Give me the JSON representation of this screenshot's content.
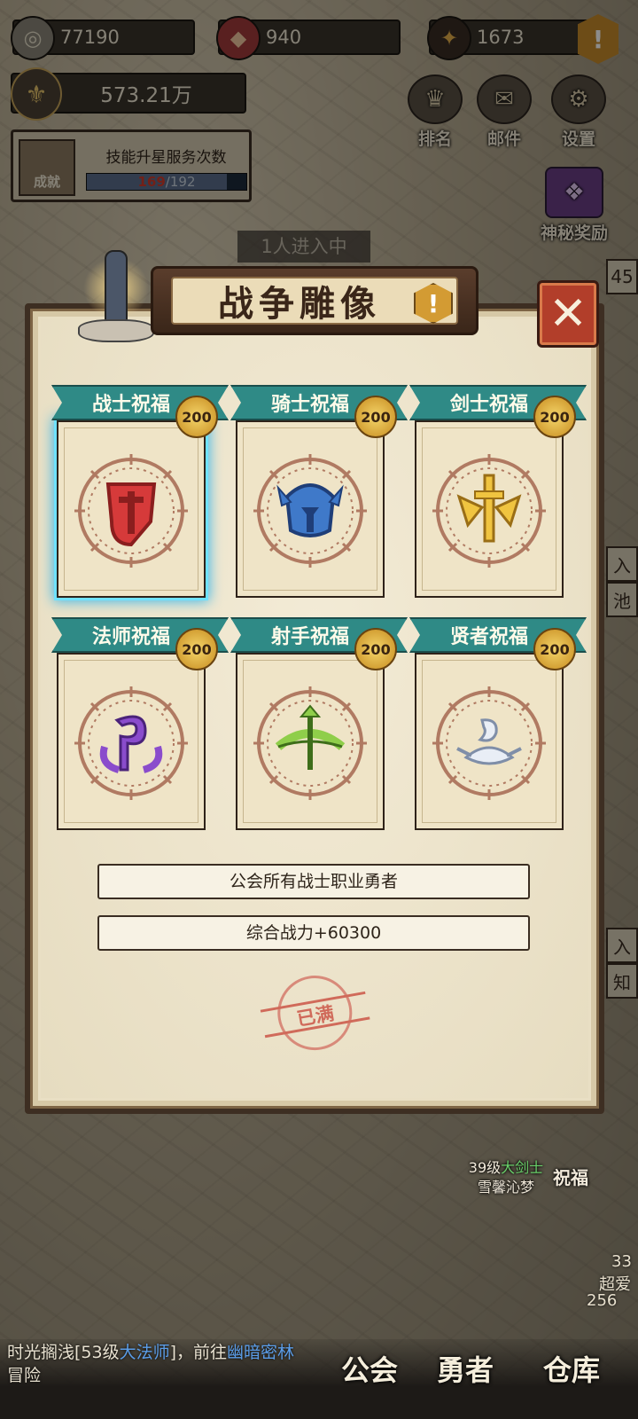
{
  "resources": {
    "gold": "77190",
    "gems": "940",
    "stars": "1673",
    "power": "573.21万"
  },
  "icons": {
    "gold": "coin-icon",
    "gems": "red-gem-icon",
    "stars": "dark-star-icon",
    "alert": "exclamation-icon"
  },
  "top_buttons": {
    "rank": "排名",
    "mail": "邮件",
    "settings": "设置",
    "mystery_reward": "神秘奖励"
  },
  "achievement": {
    "badge": "成就",
    "title": "技能升星服务次数",
    "current": "169",
    "separator": "/",
    "max": "192",
    "progress": 0.88
  },
  "map_banner": "1人进入中",
  "modal": {
    "title": "战争雕像",
    "alert": "!",
    "close": "✕",
    "cards": [
      {
        "label": "战士祝福",
        "level": "200",
        "color": "#d63a3a",
        "accent": "#8a1e1e",
        "icon": "shield-sword-icon"
      },
      {
        "label": "骑士祝福",
        "level": "200",
        "color": "#3f79c9",
        "accent": "#1f3e78",
        "icon": "winged-helmet-icon"
      },
      {
        "label": "剑士祝福",
        "level": "200",
        "color": "#f0c440",
        "accent": "#9a6e16",
        "icon": "winged-sword-icon"
      },
      {
        "label": "法师祝福",
        "level": "200",
        "color": "#8a4ccc",
        "accent": "#4a227a",
        "icon": "arcane-rune-icon"
      },
      {
        "label": "射手祝福",
        "level": "200",
        "color": "#8fce4a",
        "accent": "#3e6e1a",
        "icon": "crossbow-icon"
      },
      {
        "label": "贤者祝福",
        "level": "200",
        "color": "#e9eef6",
        "accent": "#7f8ea8",
        "icon": "sage-wings-icon"
      }
    ],
    "target": "公会所有战士职业勇者",
    "bonus": "综合战力+60300",
    "stamp": "已满"
  },
  "side": {
    "num_a": "45",
    "ch_a": "入",
    "ch_b": "池",
    "ch_c": "入",
    "ch_d": "知",
    "num_b": "33",
    "text_b": "超爱",
    "num_c": "256"
  },
  "hero": {
    "level": "39级",
    "class": "大剑士",
    "name": "雪馨沁梦",
    "bless": "祝福"
  },
  "chat": {
    "name": "时光搁浅[53级",
    "class": "大法师",
    "mid": "]，前往",
    "place": "幽暗密林",
    "tail": "冒险"
  },
  "nav": {
    "guild": "公会",
    "hero": "勇者",
    "storage": "仓库"
  }
}
